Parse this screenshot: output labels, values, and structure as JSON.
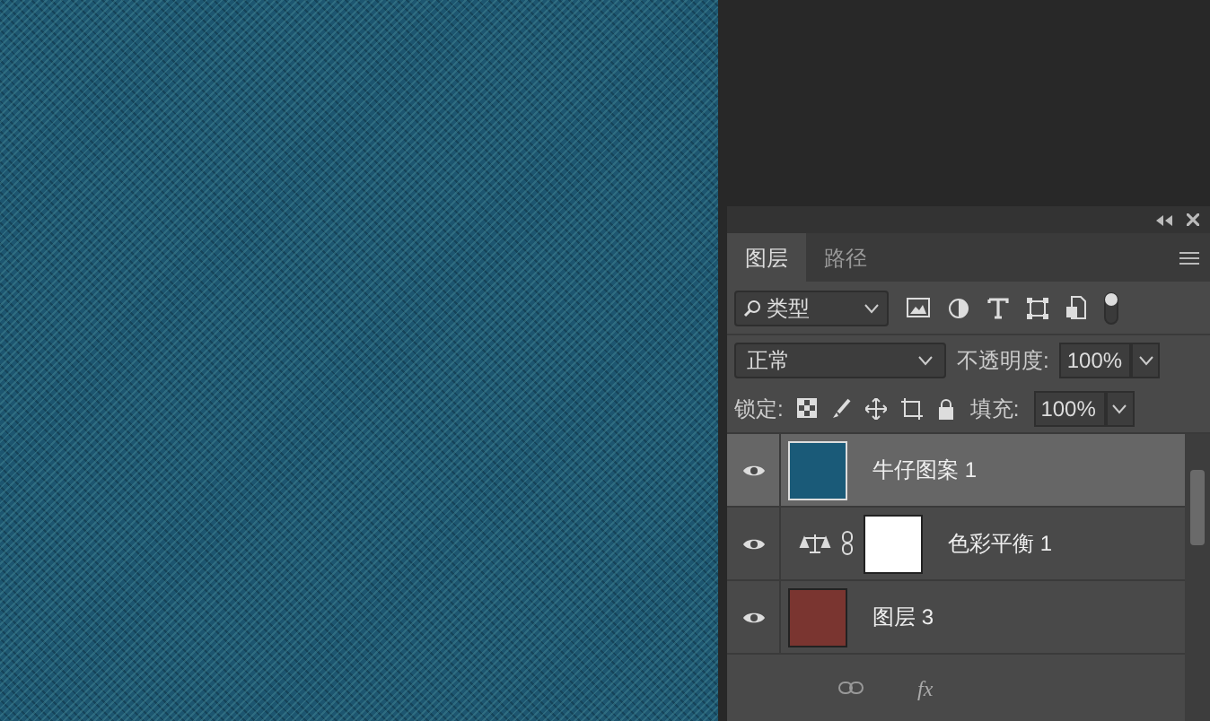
{
  "tabs": [
    {
      "label": "图层",
      "selected": true
    },
    {
      "label": "路径",
      "selected": false
    }
  ],
  "filter": {
    "value": "类型"
  },
  "blend_mode": "正常",
  "opacity_label": "不透明度:",
  "opacity": "100%",
  "lock_label": "锁定:",
  "fill_label": "填充:",
  "fill": "100%",
  "layers": [
    {
      "name": "牛仔图案 1",
      "kind": "pattern",
      "visible": true,
      "selected": true,
      "color": "#1a5a78"
    },
    {
      "name": "色彩平衡 1",
      "kind": "adjustment",
      "visible": true,
      "selected": false,
      "color": "#ffffff"
    },
    {
      "name": "图层 3",
      "kind": "pixel",
      "visible": true,
      "selected": false,
      "color": "#7a3530"
    }
  ],
  "footer": {
    "fx": "fx"
  }
}
